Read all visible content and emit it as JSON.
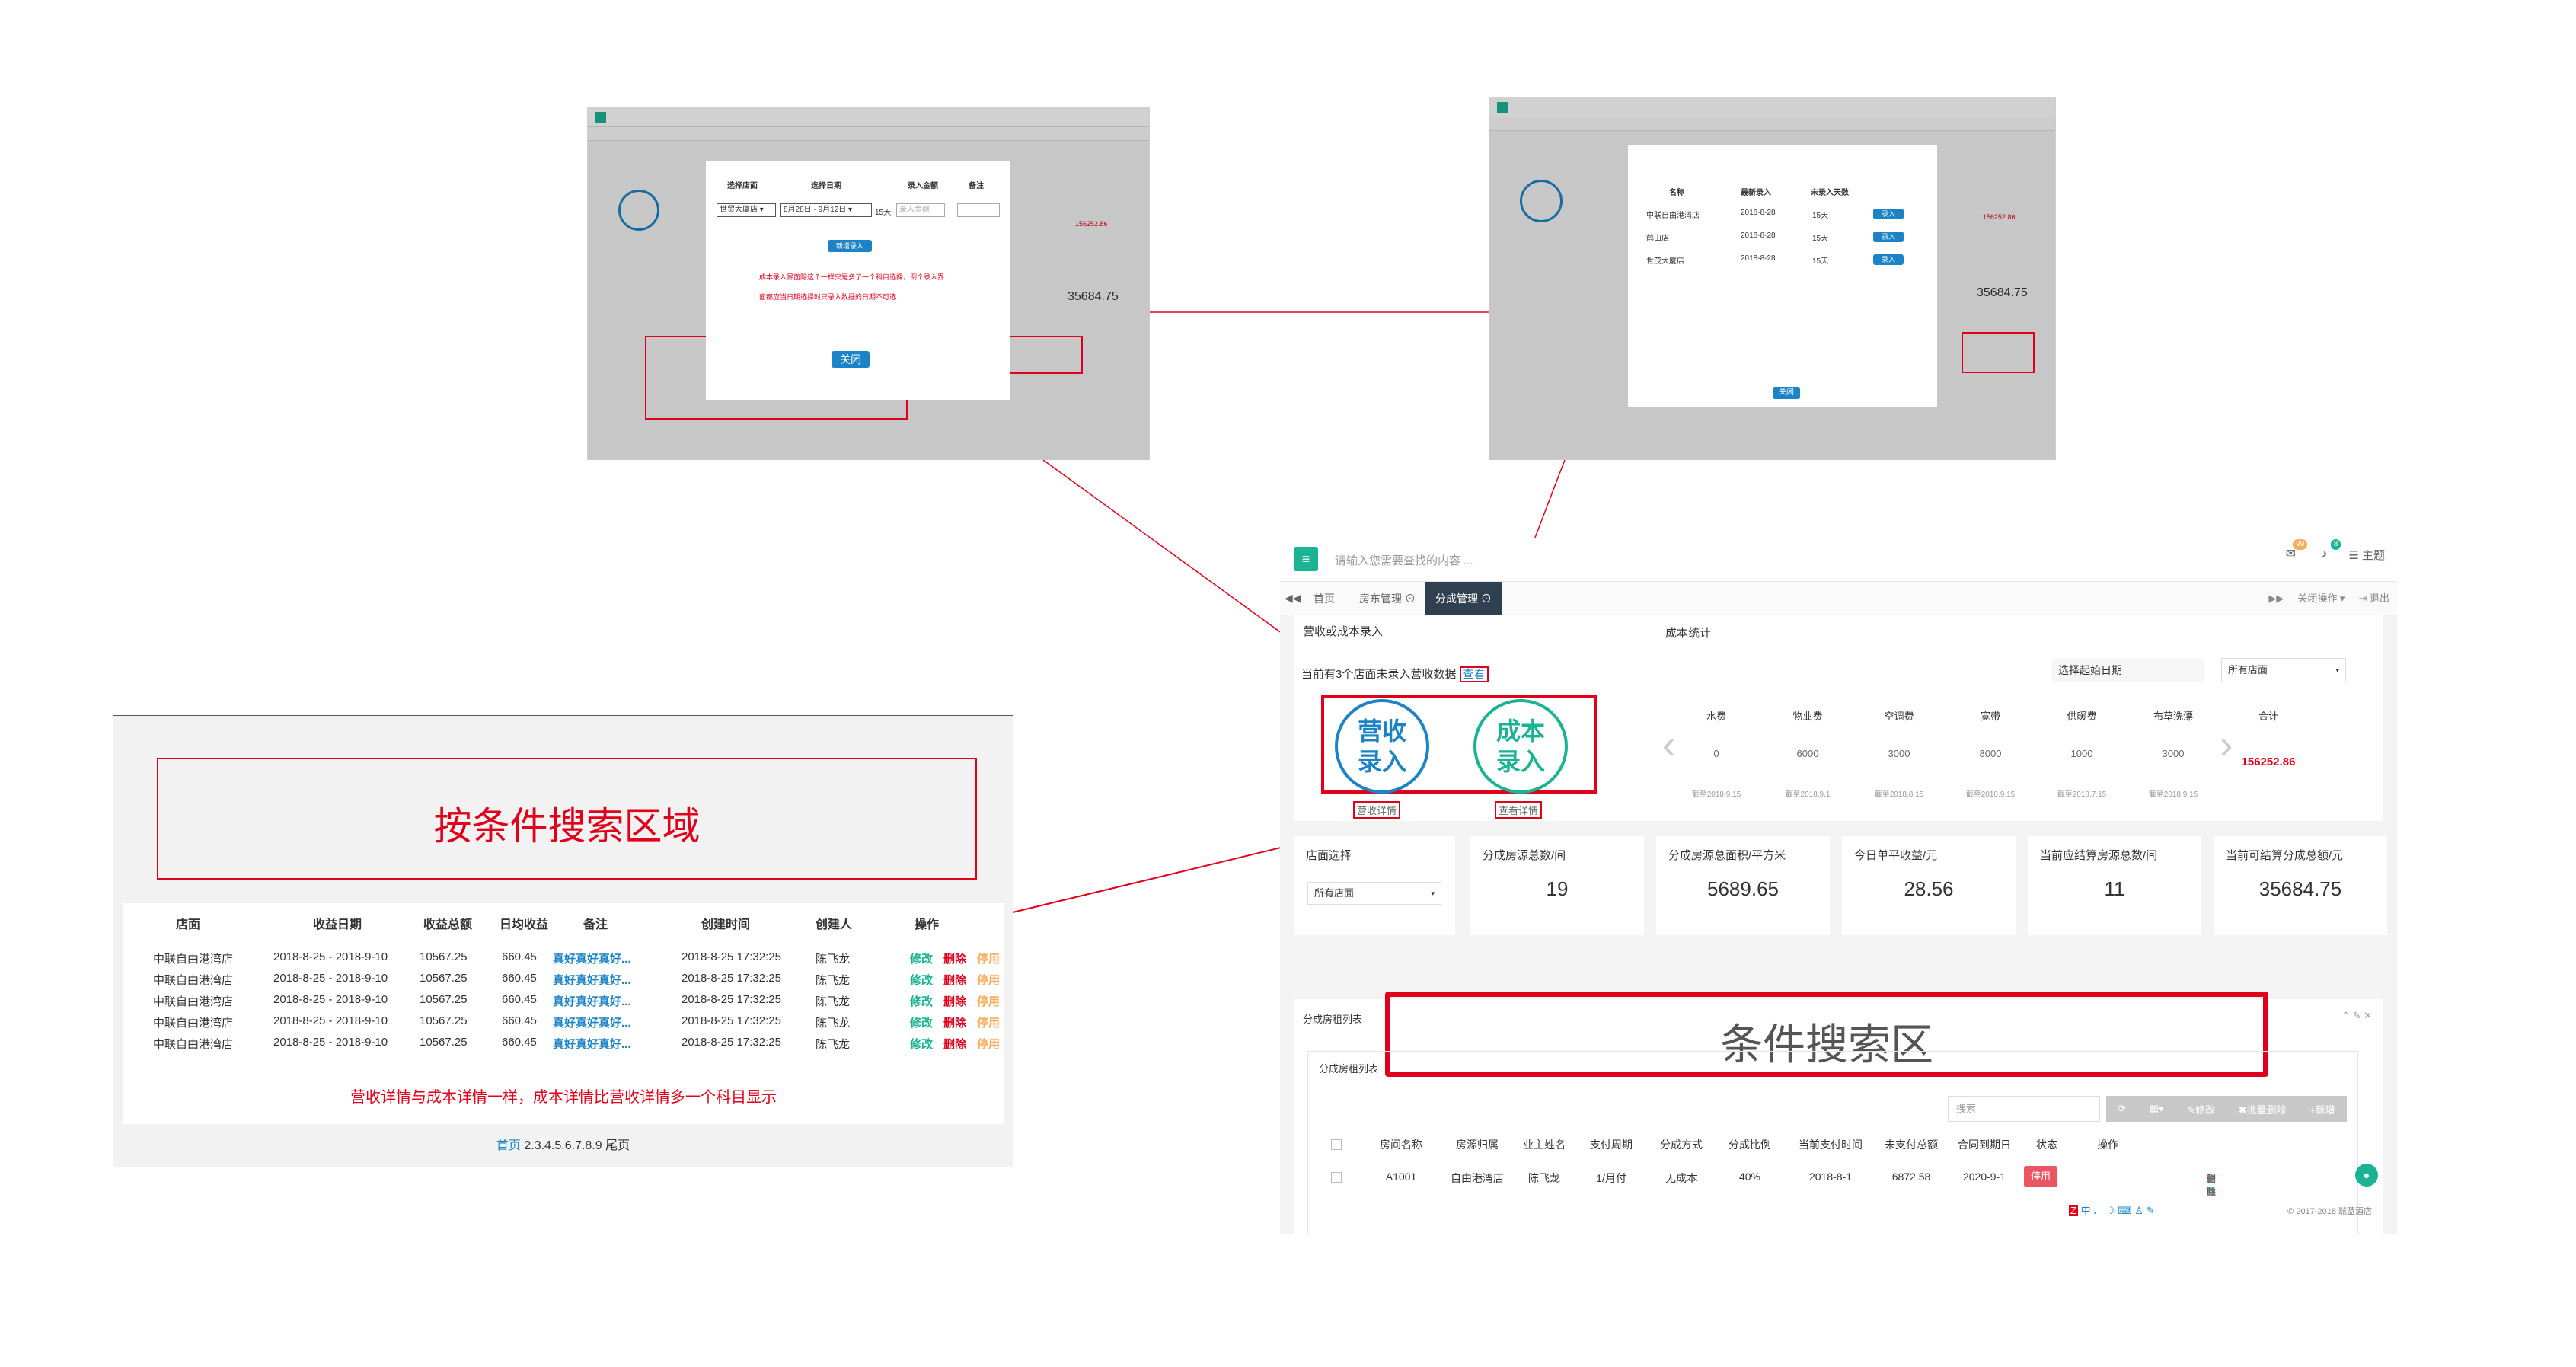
{
  "main": {
    "search_placeholder": "请输入您需要查找的内容 ...",
    "badge_count_1": "99",
    "badge_count_2": "8",
    "theme_label": "主题",
    "tabs": [
      "首页",
      "房东管理 ⊙",
      "分成管理 ⊙"
    ],
    "tab_close_ops": "关闭操作 ▾",
    "tab_exit": "退出",
    "entry_section_title": "营收或成本录入",
    "cost_section_title": "成本统计",
    "not_recorded_text": "当前有3个店面未录入营收数据",
    "view_link": "查看",
    "revenue_circle": [
      "营收",
      "录入"
    ],
    "cost_circle": [
      "成本",
      "录入"
    ],
    "view_detail_1": "营收详情",
    "view_detail_2": "查看详情",
    "start_date_placeholder": "选择起始日期",
    "all_stores": "所有店面",
    "cost_columns": [
      {
        "name": "水费",
        "value": "0",
        "date": "截至2018.9.15"
      },
      {
        "name": "物业费",
        "value": "6000",
        "date": "截至2018.9.1"
      },
      {
        "name": "空调费",
        "value": "3000",
        "date": "截至2018.8.15"
      },
      {
        "name": "宽带",
        "value": "8000",
        "date": "截至2018.9.15"
      },
      {
        "name": "供暖费",
        "value": "1000",
        "date": "截至2018.7.15"
      },
      {
        "name": "布草洗漂",
        "value": "3000",
        "date": "截至2018.9.15"
      }
    ],
    "total_label": "合计",
    "total_value": "156252.86",
    "store_select_label": "店面选择",
    "store_select_value": "所有店面",
    "stats": [
      {
        "label": "分成房源总数/间",
        "value": "19"
      },
      {
        "label": "分成房源总面积/平方米",
        "value": "5689.65"
      },
      {
        "label": "今日单平收益/元",
        "value": "28.56"
      },
      {
        "label": "当前应结算房源总数/间",
        "value": "11"
      },
      {
        "label": "当前可结算分成总额/元",
        "value": "35684.75"
      }
    ],
    "list_title": "分成房租列表",
    "list_sub_title": "分成房租列表",
    "condition_area": "条件搜索区",
    "search_placeholder2": "搜索",
    "btn_edit": "修改",
    "btn_batch_delete": "批量删除",
    "btn_add": "+新增",
    "table_headers": [
      "房间名称",
      "房源归属",
      "业主姓名",
      "支付周期",
      "分成方式",
      "分成比例",
      "当前支付时间",
      "未支付总额",
      "合同到期日",
      "状态",
      "操作"
    ],
    "table_row": [
      "A1001",
      "自由港湾店",
      "陈飞龙",
      "1/月付",
      "无成本",
      "40%",
      "2018-8-1",
      "6872.58",
      "2020-9-1",
      "停用"
    ],
    "row_actions": [
      "付款",
      "修改",
      "删除",
      "启用"
    ],
    "footer": "© 2017-2018 瑞蓝酒店"
  },
  "annot": {
    "search_area_title": "按条件搜索区域",
    "headers": [
      "店面",
      "收益日期",
      "收益总额",
      "日均收益",
      "备注",
      "创建时间",
      "创建人",
      "操作"
    ],
    "rows": [
      [
        "中联自由港湾店",
        "2018-8-25 - 2018-9-10",
        "10567.25",
        "660.45",
        "真好真好真好...",
        "2018-8-25  17:32:25",
        "陈飞龙"
      ],
      [
        "中联自由港湾店",
        "2018-8-25 - 2018-9-10",
        "10567.25",
        "660.45",
        "真好真好真好...",
        "2018-8-25  17:32:25",
        "陈飞龙"
      ],
      [
        "中联自由港湾店",
        "2018-8-25 - 2018-9-10",
        "10567.25",
        "660.45",
        "真好真好真好...",
        "2018-8-25  17:32:25",
        "陈飞龙"
      ],
      [
        "中联自由港湾店",
        "2018-8-25 - 2018-9-10",
        "10567.25",
        "660.45",
        "真好真好真好...",
        "2018-8-25  17:32:25",
        "陈飞龙"
      ],
      [
        "中联自由港湾店",
        "2018-8-25 - 2018-9-10",
        "10567.25",
        "660.45",
        "真好真好真好...",
        "2018-8-25  17:32:25",
        "陈飞龙"
      ]
    ],
    "row_ops": [
      "修改",
      "删除",
      "停用"
    ],
    "note": "营收详情与成本详情一样，成本详情比营收详情多一个科目显示",
    "pager_first": "首页",
    "pager_pages": "2.3.4.5.6.7.8.9",
    "pager_last": "尾页"
  },
  "thumb_left": {
    "headers": [
      "选择店面",
      "选择日期",
      "录入金额",
      "备注"
    ],
    "store": "世贸大厦店 ▾",
    "date_range": "8月28日 - 9月12日 ▾",
    "days": "15天",
    "amount_placeholder": "录入金额",
    "add_btn": "新增录入",
    "note_line1": "成本录入界面除这个一样只是多了一个科目选择，例个录入界",
    "note_line2": "面都应当日期选择时只录入数据的日期不可选",
    "close_btn": "关闭"
  },
  "thumb_right": {
    "headers": [
      "名称",
      "最新录入",
      "未录入天数"
    ],
    "rows": [
      [
        "中联自由港湾店",
        "2018-8-28",
        "15天"
      ],
      [
        "鹤山店",
        "2018-8-28",
        "15天"
      ],
      [
        "世茂大厦店",
        "2018-8-28",
        "15天"
      ]
    ],
    "row_btn": "录入",
    "close_btn": "关闭"
  },
  "colors": {
    "accent": "#1ab394",
    "brand_dark": "#2f4050",
    "alert_red": "#e0001b",
    "blue": "#1c84c6"
  }
}
